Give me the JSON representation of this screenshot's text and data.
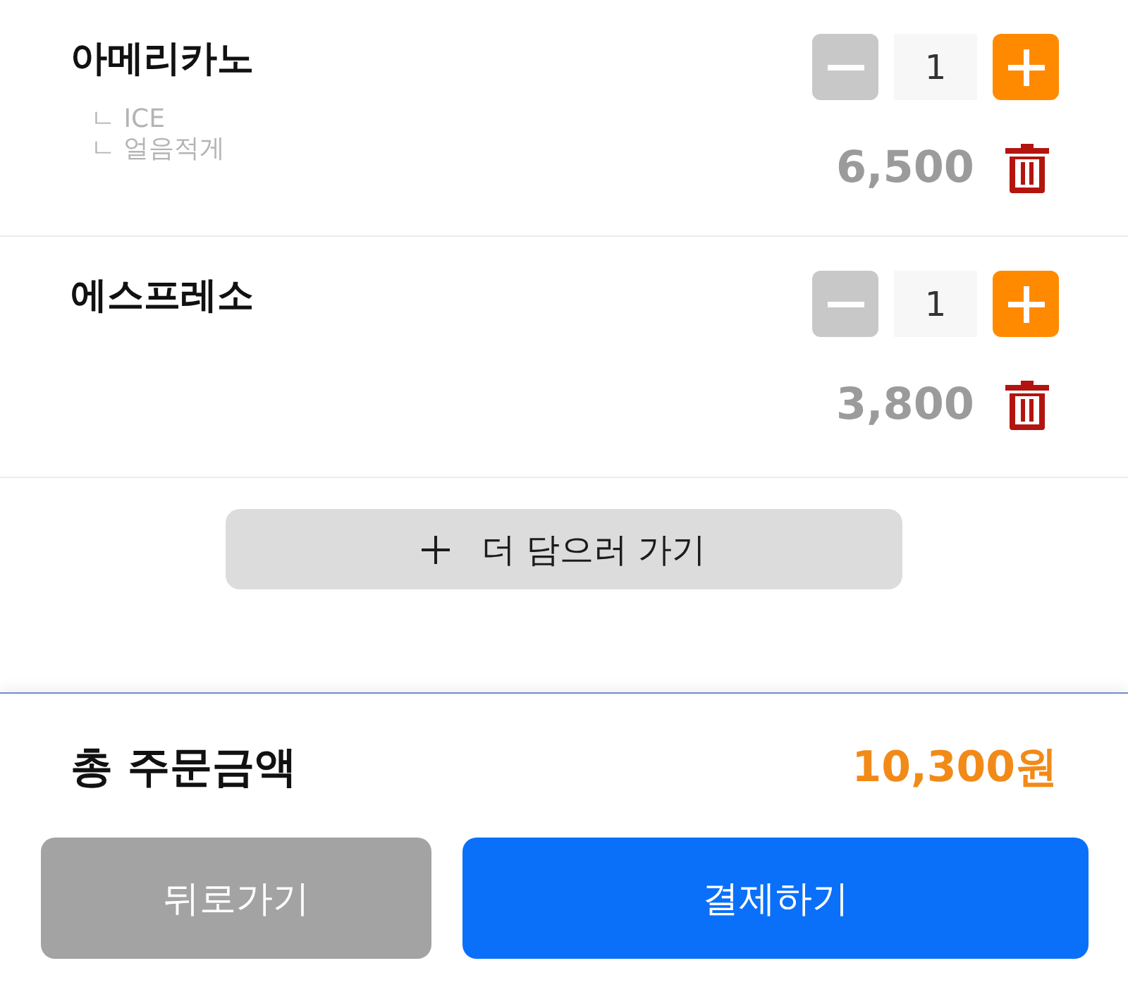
{
  "cart_items": [
    {
      "name": "아메리카노",
      "options": [
        "ㄴ ICE",
        "ㄴ 얼음적게"
      ],
      "quantity": "1",
      "decrease_disabled": true,
      "price": "6,500"
    },
    {
      "name": "에스프레소",
      "quantity": "1",
      "decrease_disabled": true,
      "price": "3,800"
    }
  ],
  "add_more_button": {
    "label": "더 담으러 가기"
  },
  "total": {
    "label": "총 주문금액",
    "amount": "10,300원"
  },
  "actions": [
    {
      "kind": "secondary",
      "label": "뒤로가기"
    },
    {
      "kind": "primary",
      "label": "결제하기"
    }
  ]
}
